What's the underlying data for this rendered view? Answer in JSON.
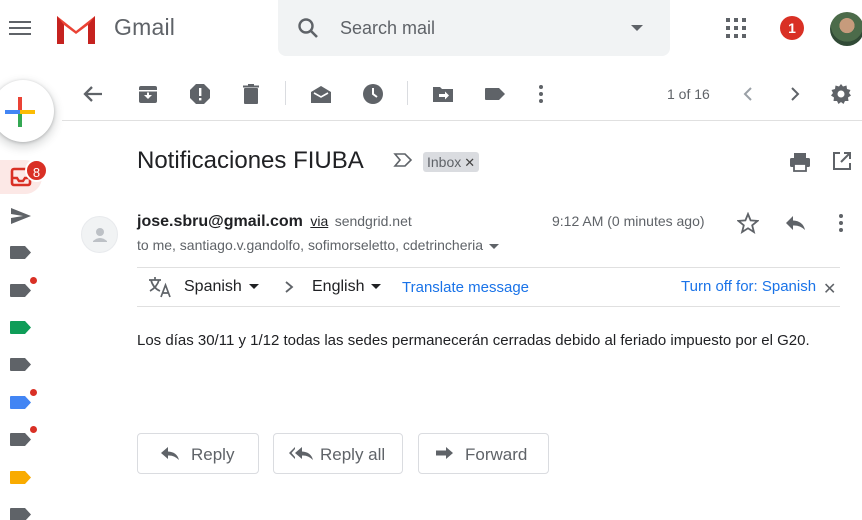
{
  "app": {
    "name": "Gmail"
  },
  "search": {
    "placeholder": "Search mail"
  },
  "header": {
    "notification_count": "1"
  },
  "sidebar": {
    "inbox_badge": "8"
  },
  "toolbar": {
    "pager": "1 of 16"
  },
  "email": {
    "subject": "Notificaciones FIUBA",
    "label": "Inbox",
    "sender_email": "jose.sbru@gmail.com",
    "via_label": "via",
    "via_domain": "sendgrid.net",
    "recipients": "to me, santiago.v.gandolfo, sofimorseletto, cdetrincheria",
    "time": "9:12 AM (0 minutes ago)",
    "body": "Los días 30/11 y 1/12 todas las sedes permanecerán cerradas debido al feriado impuesto por el G20."
  },
  "translate": {
    "from_language": "Spanish",
    "to_language": "English",
    "translate_link": "Translate message",
    "turn_off_link": "Turn off for: Spanish"
  },
  "actions": {
    "reply": "Reply",
    "reply_all": "Reply all",
    "forward": "Forward"
  },
  "colors": {
    "accent_red": "#d93025",
    "link_blue": "#1a73e8",
    "label_green": "#0f9d58",
    "label_blue": "#4285f4",
    "label_orange": "#f9ab00",
    "icon_grey": "#5f6368"
  }
}
